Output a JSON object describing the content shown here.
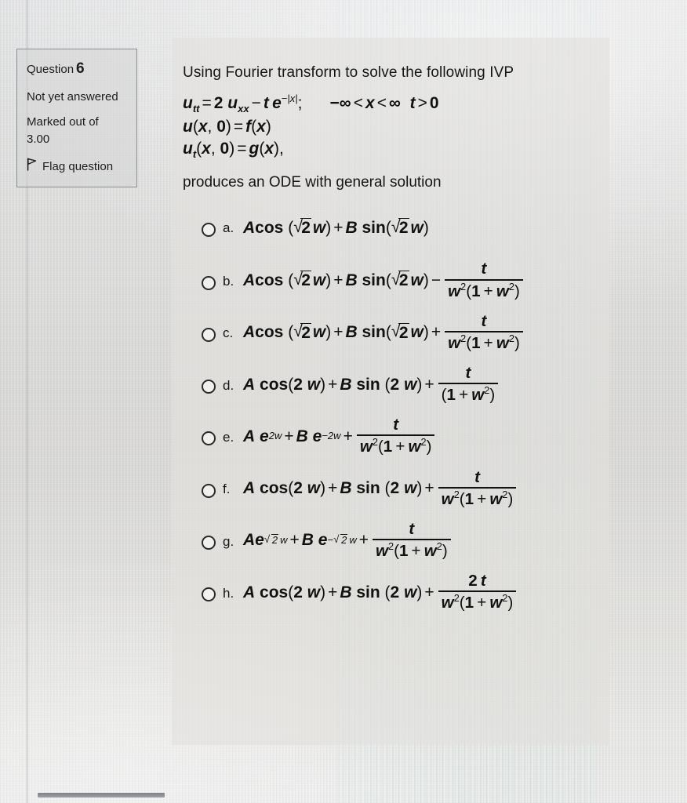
{
  "meta_box": {
    "question_label": "Question",
    "question_number": "6",
    "status": "Not yet answered",
    "marked_label": "Marked out of",
    "marked_value": "3.00",
    "flag_label": "Flag question",
    "flag_icon": "flag-icon",
    "border_color": "#8c8f93"
  },
  "question": {
    "intro": "Using Fourier transform to solve the following IVP",
    "equations": [
      "u_tt = 2 u_xx - t e^(-|x|) ;    -∞ < x < ∞   t > 0",
      "u(x, 0) = f(x)",
      "u_t(x, 0) = g(x),"
    ],
    "produces": "produces an ODE with general solution"
  },
  "answers": [
    {
      "letter": "a.",
      "selected": false,
      "text": "Acos (√2 w) + B sin(√2 w)",
      "form": "trig_sqrt2",
      "fraction": null
    },
    {
      "letter": "b.",
      "selected": false,
      "text": "Acos (√2 w) + B sin(√2 w) − t / (w²(1 + w²))",
      "form": "trig_sqrt2",
      "operator": "−",
      "fraction": {
        "numerator": "t",
        "denominator": "w²(1 + w²)"
      }
    },
    {
      "letter": "c.",
      "selected": false,
      "text": "Acos (√2 w) + B sin(√2 w) + t / (w²(1 + w²))",
      "form": "trig_sqrt2",
      "operator": "+",
      "fraction": {
        "numerator": "t",
        "denominator": "w²(1 + w²)"
      }
    },
    {
      "letter": "d.",
      "selected": false,
      "text": "A cos(2 w) + B sin (2 w) + t / (1 + w²)",
      "form": "trig_2w",
      "operator": "+",
      "fraction": {
        "numerator": "t",
        "denominator": "(1 + w²)"
      }
    },
    {
      "letter": "e.",
      "selected": false,
      "text": "A e^(2w) + B e^(-2w) + t / (w²(1 + w²))",
      "form": "exp_2w",
      "operator": "+",
      "fraction": {
        "numerator": "t",
        "denominator": "w²(1 + w²)"
      }
    },
    {
      "letter": "f.",
      "selected": false,
      "text": "A cos(2 w) + B sin (2 w) + t / (w²(1 + w²))",
      "form": "trig_2w",
      "operator": "+",
      "fraction": {
        "numerator": "t",
        "denominator": "w²(1 + w²)"
      }
    },
    {
      "letter": "g.",
      "selected": false,
      "text": "Ae^(√2 w) + B e^(-√2 w) + t / (w²(1 + w²))",
      "form": "exp_sqrt2w",
      "operator": "+",
      "fraction": {
        "numerator": "t",
        "denominator": "w²(1 + w²)"
      }
    },
    {
      "letter": "h.",
      "selected": false,
      "text": "A cos(2 w) + B sin (2 w) + 2t / (w²(1 + w²))",
      "form": "trig_2w",
      "operator": "+",
      "fraction": {
        "numerator": "2 t",
        "denominator": "w²(1 + w²)"
      }
    }
  ]
}
